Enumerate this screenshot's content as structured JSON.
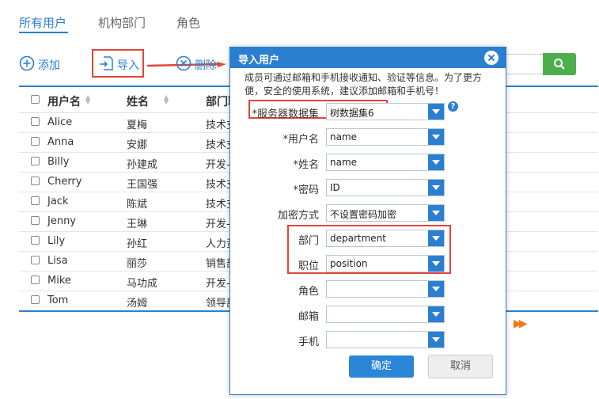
{
  "tabs": [
    {
      "label": "所有用户",
      "active": true
    },
    {
      "label": "机构部门",
      "active": false
    },
    {
      "label": "角色",
      "active": false
    }
  ],
  "toolbar": {
    "add_label": "添加",
    "import_label": "导入",
    "delete_label": "删除"
  },
  "table": {
    "headers": [
      "用户名",
      "姓名",
      "部门职"
    ],
    "rows": [
      {
        "username": "Alice",
        "name": "夏梅",
        "dept": "技术支"
      },
      {
        "username": "Anna",
        "name": "安娜",
        "dept": "技术支"
      },
      {
        "username": "Billy",
        "name": "孙建成",
        "dept": "开发-销"
      },
      {
        "username": "Cherry",
        "name": "王国强",
        "dept": "技术支"
      },
      {
        "username": "Jack",
        "name": "陈斌",
        "dept": "技术支"
      },
      {
        "username": "Jenny",
        "name": "王琳",
        "dept": "开发-销"
      },
      {
        "username": "Lily",
        "name": "孙红",
        "dept": "人力资"
      },
      {
        "username": "Lisa",
        "name": "丽莎",
        "dept": "销售部"
      },
      {
        "username": "Mike",
        "name": "马功成",
        "dept": "开发-销"
      },
      {
        "username": "Tom",
        "name": "汤姆",
        "dept": "领导部"
      }
    ]
  },
  "pager": {
    "next_symbol": "▶▶"
  },
  "modal": {
    "title": "导入用户",
    "note": "成员可通过邮箱和手机接收通知、验证等信息。为了更方便，安全的使用系统，建议添加邮箱和手机号！",
    "help_symbol": "?",
    "fields": [
      {
        "label": "*服务器数据集",
        "value": "树数据集6"
      },
      {
        "label": "*用户名",
        "value": "name"
      },
      {
        "label": "*姓名",
        "value": "name"
      },
      {
        "label": "*密码",
        "value": "ID"
      },
      {
        "label": "加密方式",
        "value": "不设置密码加密"
      },
      {
        "label": "部门",
        "value": "department"
      },
      {
        "label": "职位",
        "value": "position"
      },
      {
        "label": "角色",
        "value": ""
      },
      {
        "label": "邮箱",
        "value": ""
      },
      {
        "label": "手机",
        "value": ""
      }
    ],
    "ok_label": "确定",
    "cancel_label": "取消"
  },
  "colors": {
    "accent": "#2b7fd1",
    "highlight": "#e0463a",
    "search": "#4cae4c",
    "pager": "#f07a12"
  }
}
